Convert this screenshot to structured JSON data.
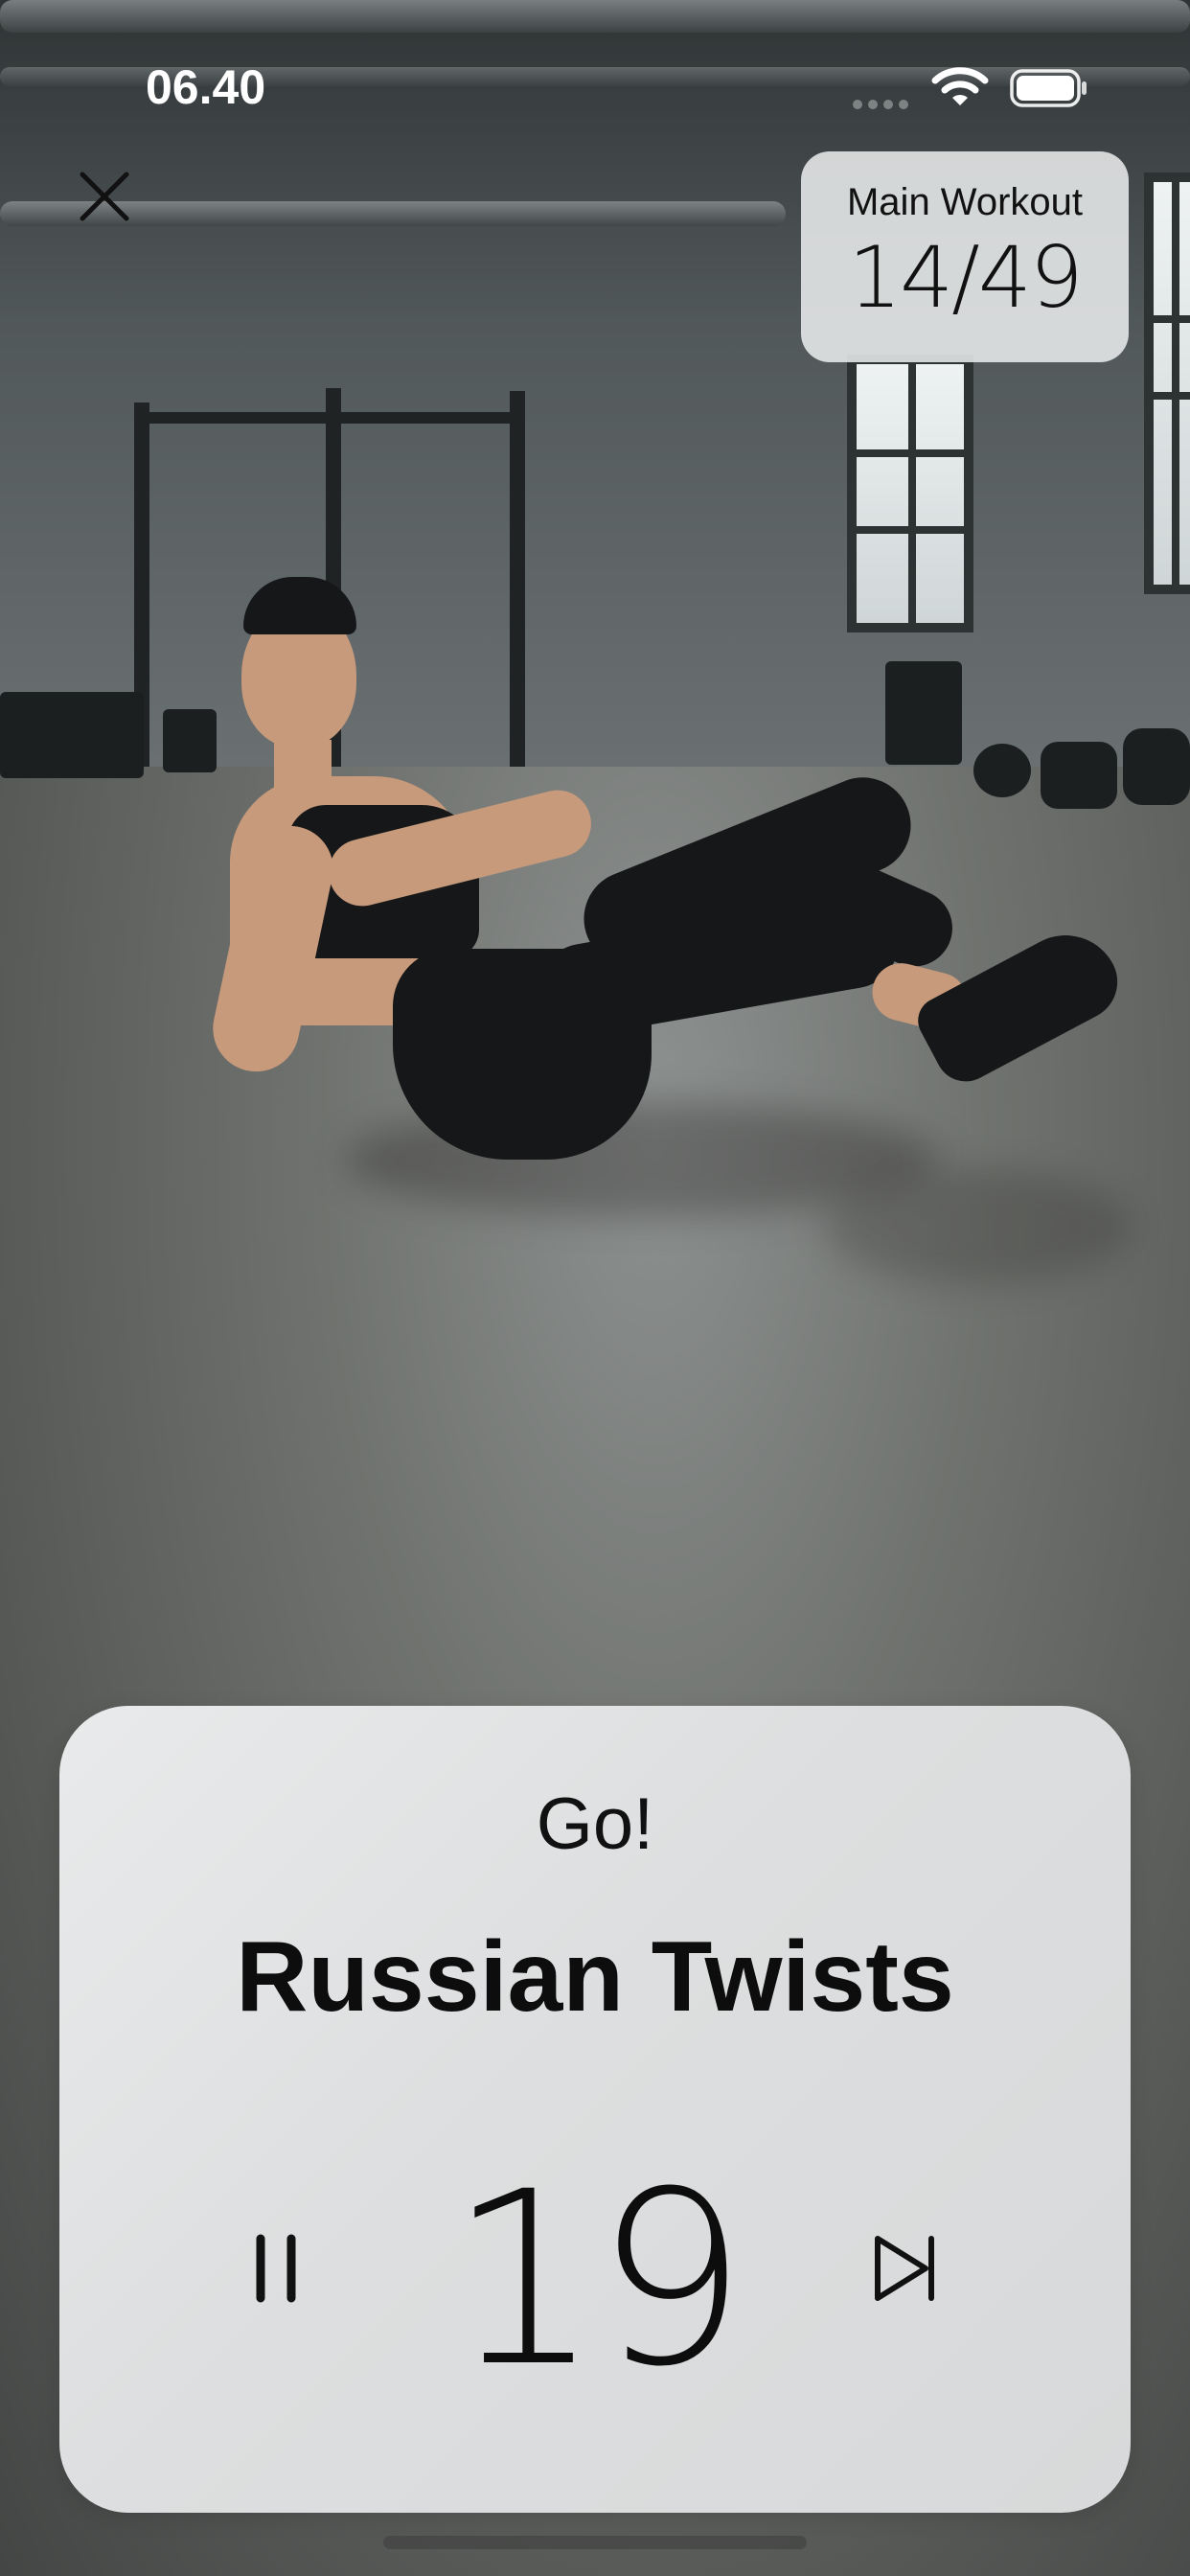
{
  "status_bar": {
    "time": "06.40",
    "wifi_icon": "wifi-icon",
    "battery_icon": "battery-icon"
  },
  "header": {
    "close_icon": "close-icon",
    "workout_name": "Main Workout",
    "progress": "14/49"
  },
  "exercise": {
    "prompt": "Go!",
    "name": "Russian Twists",
    "seconds_remaining": "19",
    "pause_icon": "pause-icon",
    "skip_icon": "skip-forward-icon"
  },
  "colors": {
    "card_background": "#e3e5e6",
    "text": "#0d0d0d",
    "icon": "#111111"
  }
}
